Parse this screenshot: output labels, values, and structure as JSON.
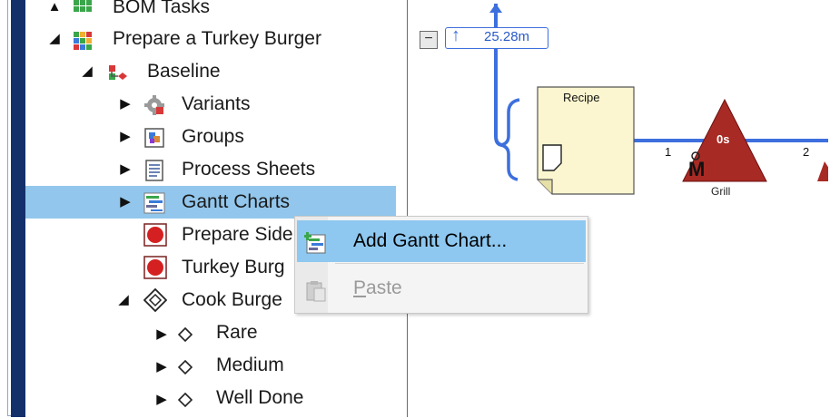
{
  "tree": {
    "items": [
      {
        "label": "BOM Tasks",
        "arrow": "▲"
      },
      {
        "label": "Prepare a Turkey Burger",
        "arrow": "◢"
      },
      {
        "label": "Baseline",
        "arrow": "◢"
      },
      {
        "label": "Variants",
        "arrow": "▶"
      },
      {
        "label": "Groups",
        "arrow": "▶"
      },
      {
        "label": "Process Sheets",
        "arrow": "▶"
      },
      {
        "label": "Gantt Charts",
        "arrow": "▶"
      },
      {
        "label": "Prepare Side",
        "arrow": ""
      },
      {
        "label": "Turkey Burg",
        "arrow": ""
      },
      {
        "label": "Cook Burge",
        "arrow": "◢"
      },
      {
        "label": "Rare",
        "arrow": "▶"
      },
      {
        "label": "Medium",
        "arrow": "▶"
      },
      {
        "label": "Well Done",
        "arrow": "▶"
      }
    ]
  },
  "context_menu": {
    "items": [
      {
        "label": "Add Gantt Chart..."
      },
      {
        "label": "Paste",
        "underline_char": "P",
        "rest": "aste"
      }
    ]
  },
  "canvas": {
    "collapse_glyph": "−",
    "time_label": "25.28m",
    "recipe_label": "Recipe",
    "flow_number_1": "1",
    "flow_number_2": "2",
    "grill_time": "0s",
    "grill_letter": "M",
    "grill_label": "Grill"
  },
  "colors": {
    "navy": "#14306b",
    "selection": "#92c6ec",
    "menu_highlight": "#8ec8f0",
    "flow_blue": "#3d6fdd",
    "operation_red": "#a82a24",
    "recipe_fill": "#fbf6cf"
  }
}
